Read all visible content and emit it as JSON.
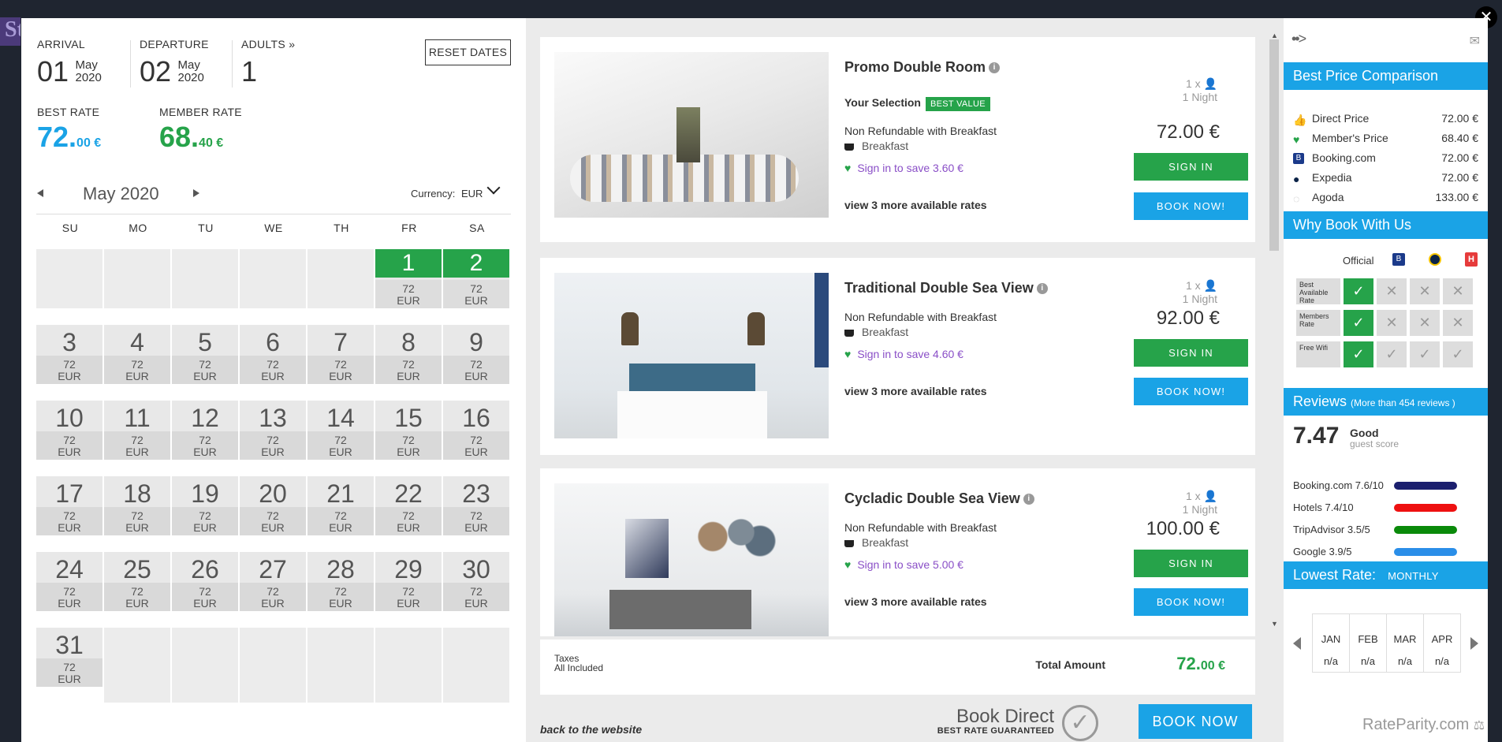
{
  "bg_logo": "St",
  "close_icon": "✕",
  "header": {
    "arrival_label": "ARRIVAL",
    "arrival_day": "01",
    "arrival_month": "May",
    "arrival_year": "2020",
    "departure_label": "DEPARTURE",
    "departure_day": "02",
    "departure_month": "May",
    "departure_year": "2020",
    "adults_label": "ADULTS",
    "adults_value": "1",
    "adults_chev": "»",
    "reset_label": "RESET DATES"
  },
  "rates": {
    "best_label": "BEST RATE",
    "best_int": "72.",
    "best_dec": "00 €",
    "member_label": "MEMBER RATE",
    "member_int": "68.",
    "member_dec": "40 €"
  },
  "calendar": {
    "month_label": "May 2020",
    "currency_label": "Currency:",
    "currency_value": "EUR",
    "weekdays": [
      "SU",
      "MO",
      "TU",
      "WE",
      "TH",
      "FR",
      "SA"
    ],
    "price": "72",
    "cur": "EUR",
    "days": [
      "1",
      "2",
      "3",
      "4",
      "5",
      "6",
      "7",
      "8",
      "9",
      "10",
      "11",
      "12",
      "13",
      "14",
      "15",
      "16",
      "17",
      "18",
      "19",
      "20",
      "21",
      "22",
      "23",
      "24",
      "25",
      "26",
      "27",
      "28",
      "29",
      "30",
      "31"
    ],
    "selected": [
      "1",
      "2"
    ]
  },
  "rooms": [
    {
      "name": "Promo Double Room",
      "selection_label": "Your Selection",
      "badge": "BEST VALUE",
      "desc": "Non Refundable with Breakfast",
      "breakfast": "Breakfast",
      "save": "Sign in to save 3.60 €",
      "more": "view 3 more available rates",
      "persons": "1 x",
      "nights": "1 Night",
      "price": "72.00 €",
      "sign_in": "SIGN IN",
      "book": "BOOK NOW!"
    },
    {
      "name": "Traditional Double Sea View",
      "desc": "Non Refundable with Breakfast",
      "breakfast": "Breakfast",
      "save": "Sign in to save 4.60 €",
      "more": "view 3 more available rates",
      "persons": "1 x",
      "nights": "1 Night",
      "price": "92.00 €",
      "sign_in": "SIGN IN",
      "book": "BOOK NOW!"
    },
    {
      "name": "Cycladic Double Sea View",
      "desc": "Non Refundable with Breakfast",
      "breakfast": "Breakfast",
      "save": "Sign in to save 5.00 €",
      "more": "view 3 more available rates",
      "persons": "1 x",
      "nights": "1 Night",
      "price": "100.00 €",
      "sign_in": "SIGN IN",
      "book": "BOOK NOW!"
    }
  ],
  "total": {
    "taxes": "Taxes",
    "included": "All Included",
    "label": "Total Amount",
    "int": "72.",
    "dec": "00 €"
  },
  "footer": {
    "back_link": "back to the website",
    "book_direct": "Book Direct",
    "guarantee": "BEST RATE GUARANTEED",
    "book_now": "BOOK NOW"
  },
  "sidebar": {
    "nav_icon": "••>",
    "collapse_icon": "✉",
    "price_comparison_title": "Best Price Comparison",
    "prices": [
      {
        "name": "Direct Price",
        "value": "72.00 €",
        "icon": "thumbs-up-icon"
      },
      {
        "name": "Member's Price",
        "value": "68.40 €",
        "icon": "heart-icon"
      },
      {
        "name": "Booking.com",
        "value": "72.00 €",
        "icon": "booking-icon"
      },
      {
        "name": "Expedia",
        "value": "72.00 €",
        "icon": "expedia-icon"
      },
      {
        "name": "Agoda",
        "value": "133.00 €",
        "icon": "agoda-icon"
      }
    ],
    "why_title": "Why Book With Us",
    "official_label": "Official",
    "why_rows": [
      {
        "label": "Best Available Rate",
        "cells": [
          "ok",
          "x",
          "x",
          "x"
        ]
      },
      {
        "label": "Members Rate",
        "cells": [
          "ok",
          "x",
          "x",
          "x"
        ]
      },
      {
        "label": "Free Wifi",
        "cells": [
          "ok",
          "check",
          "check",
          "check"
        ]
      }
    ],
    "reviews_title": "Reviews",
    "reviews_count": "(More than 454 reviews )",
    "score": "7.47",
    "score_word": "Good",
    "score_sub": "guest score",
    "review_sources": [
      {
        "label": "Booking.com 7.6/10",
        "color": "#1b1f6e"
      },
      {
        "label": "Hotels 7.4/10",
        "color": "#ee1111"
      },
      {
        "label": "TripAdvisor 3.5/5",
        "color": "#0a8a0a"
      },
      {
        "label": "Google 3.9/5",
        "color": "#2a8ee8"
      }
    ],
    "lowest_title": "Lowest Rate:",
    "lowest_mode": "MONTHLY",
    "months": [
      {
        "m": "JAN",
        "v": "n/a"
      },
      {
        "m": "FEB",
        "v": "n/a"
      },
      {
        "m": "MAR",
        "v": "n/a"
      },
      {
        "m": "APR",
        "v": "n/a"
      }
    ],
    "brand": "RateParity.com"
  },
  "colors": {
    "accent_blue": "#1aa3e6",
    "accent_green": "#26a34a",
    "link_purple": "#8a4fc7"
  }
}
